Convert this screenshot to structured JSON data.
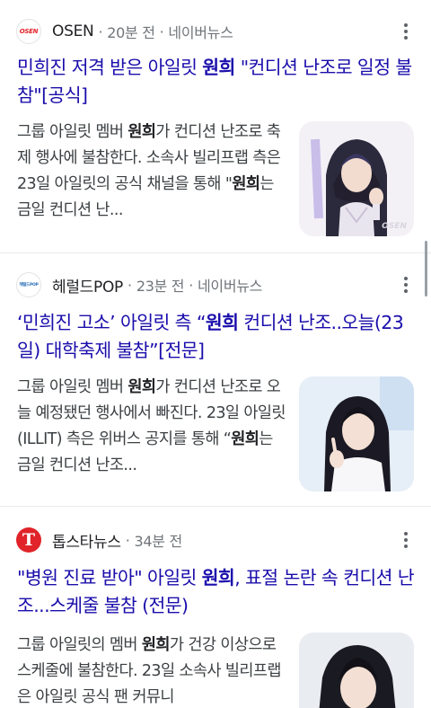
{
  "results": [
    {
      "source": {
        "name": "OSEN",
        "logo_text": "OSEN",
        "logo_color": "#e12127",
        "time": "20분 전",
        "platform": "네이버뉴스"
      },
      "headline": {
        "pre": "민희진 저격 받은 아일릿 ",
        "bold": "원희",
        "post": " \"컨디션 난조로 일정 불참\"[공식]"
      },
      "snippet": {
        "p1": "그룹 아일릿 멤버 ",
        "b1": "원희",
        "p2": "가 컨디션 난조로 축제 행사에 불참한다. 소속사 빌리프랩 측은 23일 아일릿의 공식 채널을 통해 \"",
        "b2": "원희",
        "p3": "는 금일 컨디션 난..."
      },
      "thumbnail": {
        "watermark": "OSEN",
        "background": "#f3f1f6"
      }
    },
    {
      "source": {
        "name": "헤럴드POP",
        "logo_text": "헤럴드POP",
        "logo_color": "#2a6fb7",
        "time": "23분 전",
        "platform": "네이버뉴스"
      },
      "headline": {
        "pre": "‘민희진 고소’ 아일릿 측 “",
        "bold": "원희",
        "post": " 컨디션 난조..오늘(23일) 대학축제 불참”[전문]"
      },
      "snippet": {
        "p1": "그룹 아일릿 멤버 ",
        "b1": "원희",
        "p2": "가 컨디션 난조로 오늘 예정됐던 행사에서 빠진다. 23일 아일릿(ILLIT) 측은 위버스 공지를 통해 “",
        "b2": "원희",
        "p3": "는 금일 컨디션 난조..."
      },
      "thumbnail": {
        "watermark": "",
        "background": "#e6eef7"
      }
    },
    {
      "source": {
        "name": "톱스타뉴스",
        "logo_text": "T",
        "logo_color": "#e0242a",
        "time": "34분 전",
        "platform": ""
      },
      "headline": {
        "pre": "\"병원 진료 받아\" 아일릿 ",
        "bold": "원희",
        "post": ", 표절 논란 속 컨디션 난조...스케줄 불참 (전문)"
      },
      "snippet": {
        "p1": "그룹 아일릿의 멤버 ",
        "b1": "원희",
        "p2": "가 건강 이상으로 스케줄에 불참한다. 23일 소속사 빌리프랩은 아일릿 공식 팬 커뮤니",
        "b2": "",
        "p3": ""
      },
      "thumbnail": {
        "watermark": "",
        "background": "#e9ecf1"
      }
    }
  ],
  "meta_separator": "·",
  "accent_color": "#1a0dab"
}
